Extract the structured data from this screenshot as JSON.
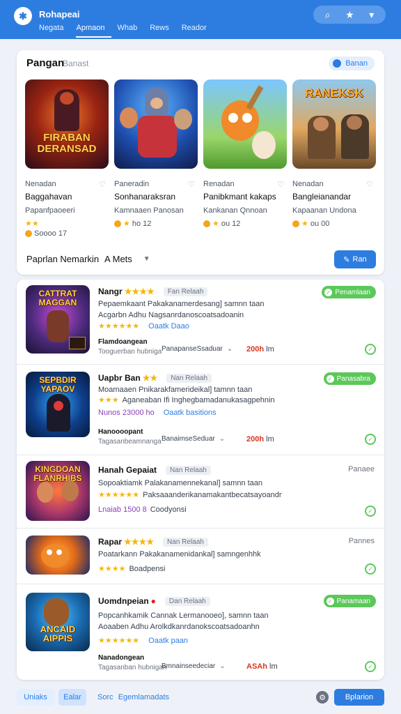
{
  "header": {
    "title": "Rohapeai",
    "nav": [
      "Negata",
      "Apmaon",
      "Whab",
      "Rews",
      "Reador"
    ],
    "active_nav": 1,
    "actions": [
      "search-icon",
      "star-icon",
      "chat-icon"
    ]
  },
  "featured": {
    "title": "Pangan",
    "subtitle": "Banast",
    "pill": "Banan",
    "filter_label": "Paprlan Nemarkin",
    "filter_value": "A Mets",
    "run_label": "Ran",
    "items": [
      {
        "art_text": "FIRABAN DERANSAD",
        "category": "Nenadan",
        "name": "Baggahavan",
        "dev": "Papanfpaoeeri",
        "stars": "★★",
        "rating": "Soooo 17"
      },
      {
        "art_text": "",
        "category": "Paneradin",
        "name": "Sonhanaraksran",
        "dev": "Kamnaaen Panosan",
        "stars": "★",
        "rating": "ho 12"
      },
      {
        "art_text": "",
        "category": "Renadan",
        "name": "Panibkmant kakaps",
        "dev": "Kankanan Qnnoan",
        "stars": "★",
        "rating": "ou 12"
      },
      {
        "art_text": "RANEKSK",
        "category": "Nenadan",
        "name": "Bangleianandar",
        "dev": "Kapaanan Undona",
        "stars": "★",
        "rating": "ou 00"
      }
    ]
  },
  "list": [
    {
      "title": "Nangr",
      "stars": "★★★★",
      "tag": "Fan Relaah",
      "badge": "Penamlaan",
      "line1": "Pepaemkaant Pakakanamerdesang] samnn taan",
      "line2": "Acgarbn Adhu Nagsanrdanoscoatsadoanin",
      "meta_stars": "★★★★★★",
      "meta_link": "Oaatk Daao",
      "dev": "Flamdoangean",
      "foot": "Tooguerban hubniga",
      "platform": "PanapanseSsaduar",
      "size": "200h",
      "size_unit": "lm",
      "art_text": "CATTRAT MAGGAN"
    },
    {
      "title": "Uapbr Ban",
      "stars": "★★",
      "tag": "Nan Relaah",
      "badge": "Panasabra",
      "line1": "Moamaaen Pnikarakfamerideikal] tamnn taan",
      "line2": "Aganeaban Ifi Inghegbamadanukasagpehnin",
      "meta_stars": "★★★",
      "meta_link": "Oaatk basitions",
      "meta_extra": "Nunos 23000 ho",
      "dev": "Hanoooopant",
      "foot": "Tagasanbeamnanga",
      "platform": "BanaimseSeduar",
      "size": "200h",
      "size_unit": "lm",
      "art_text": "SEPBDIR YAPAOV"
    },
    {
      "title": "Hanah Gepaiat",
      "stars": "",
      "tag": "Nan Relaah",
      "plain": "Panaee",
      "line1": "Sopoaktiamk Palakanamennekanal] samnn taan",
      "line2": "Paksaaanderikanamakantbecatsayoandn",
      "meta_stars": "★★★★★★",
      "meta_link": "Coodyonsi",
      "meta_extra": "Lnaiab 1500 8",
      "art_text": "KINGDOAN FLANRHIBS"
    },
    {
      "title": "Rapar",
      "stars": "★★★★",
      "tag": "Nan Relaah",
      "plain": "Pannes",
      "line1": "Poatarkann Pakakanamenidankal] samngenhhk",
      "line2": "",
      "meta_stars": "★★★★",
      "meta_link": "Boadpensi",
      "art_text": ""
    },
    {
      "title": "Uomdnpeian",
      "stars": "",
      "tag": "Dan Relaah",
      "badge": "Panamaan",
      "line1": "Popcanhkamik Cannak Lermanooeo], samnn taan",
      "line2": "Aoaaben Adhu Arolkdkanrdanokscoatsadoanhn",
      "meta_stars": "★★★★★★",
      "meta_link": "Oaatk paan",
      "dev": "Nanadongean",
      "foot": "Tagasanban hubnigan",
      "platform": "Bmnainseedeciar",
      "size": "ASAh",
      "size_unit": "lm",
      "art_text": "ANCAID AIPPIS"
    }
  ],
  "bottom": {
    "clear": "Uniaks",
    "edit": "Ealar",
    "sort_label": "Sorc",
    "sort_value": "Egemlamadats",
    "apply": "Bplarion"
  },
  "colors": {
    "accent": "#2d7de0",
    "success": "#5bc85a",
    "star": "#f5b60b"
  }
}
